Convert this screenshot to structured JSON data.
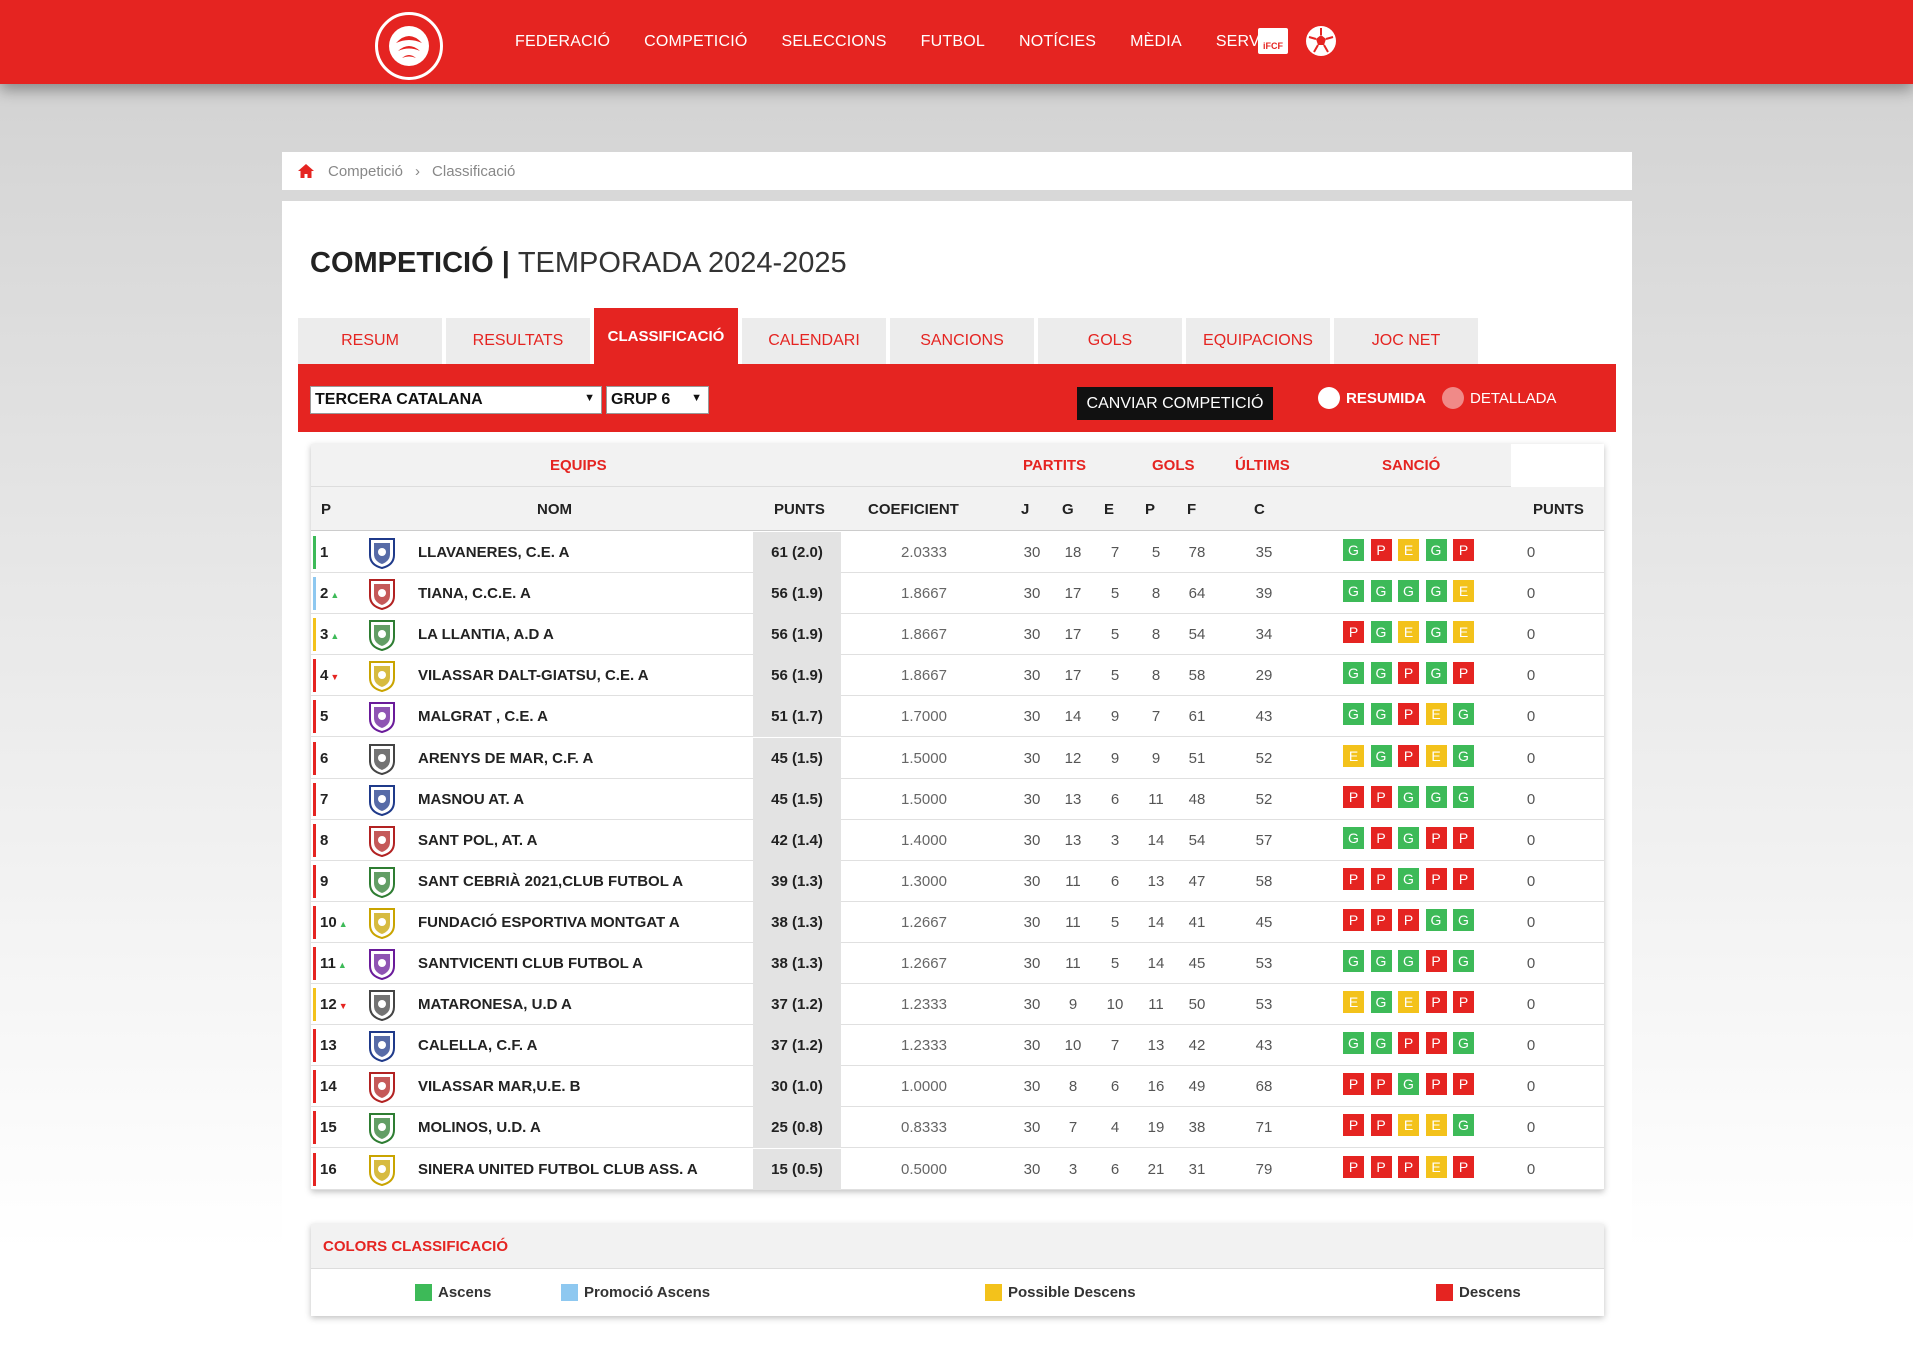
{
  "nav": {
    "items": [
      "FEDERACIÓ",
      "COMPETICIÓ",
      "SELECCIONS",
      "FUTBOL",
      "NOTÍCIES",
      "MÈDIA",
      "SERVEIS"
    ],
    "ifcf_label": "iFCF"
  },
  "breadcrumb": {
    "items": [
      "Competició",
      "Classificació"
    ],
    "separator": "›"
  },
  "title": {
    "bold": "COMPETICIÓ |",
    "light": "TEMPORADA 2024-2025"
  },
  "tabs": [
    "RESUM",
    "RESULTATS",
    "CLASSIFICACIÓ",
    "CALENDARI",
    "SANCIONS",
    "GOLS",
    "EQUIPACIONS",
    "JOC NET"
  ],
  "active_tab": "CLASSIFICACIÓ",
  "filters": {
    "competition": "TERCERA CATALANA",
    "group": "GRUP 6",
    "change_button": "CANVIAR COMPETICIÓ",
    "view_options": [
      "RESUMIDA",
      "DETALLADA"
    ],
    "selected_view": "RESUMIDA"
  },
  "table": {
    "group_headers": {
      "equips": "EQUIPS",
      "partits": "PARTITS",
      "gols": "GOLS",
      "ultims": "ÚLTIMS",
      "sancio": "SANCIÓ"
    },
    "columns": {
      "p": "P",
      "nom": "NOM",
      "punts": "PUNTS",
      "coef": "COEFICIENT",
      "j": "J",
      "g": "G",
      "e": "E",
      "pp": "P",
      "f": "F",
      "c": "C",
      "sanc": "PUNTS"
    },
    "rows": [
      {
        "pos": "1",
        "trend": "",
        "team": "LLAVANERES, C.E. A",
        "pts": "61 (2.0)",
        "coef": "2.0333",
        "j": "30",
        "g": "18",
        "e": "7",
        "p": "5",
        "f": "78",
        "c": "35",
        "form": [
          "G",
          "P",
          "E",
          "G",
          "P"
        ],
        "sanc": "0",
        "zone": "ascens"
      },
      {
        "pos": "2",
        "trend": "up",
        "team": "TIANA, C.C.E. A",
        "pts": "56 (1.9)",
        "coef": "1.8667",
        "j": "30",
        "g": "17",
        "e": "5",
        "p": "8",
        "f": "64",
        "c": "39",
        "form": [
          "G",
          "G",
          "G",
          "G",
          "E"
        ],
        "sanc": "0",
        "zone": "promocio"
      },
      {
        "pos": "3",
        "trend": "up",
        "team": "LA LLANTIA, A.D A",
        "pts": "56 (1.9)",
        "coef": "1.8667",
        "j": "30",
        "g": "17",
        "e": "5",
        "p": "8",
        "f": "54",
        "c": "34",
        "form": [
          "P",
          "G",
          "E",
          "G",
          "E"
        ],
        "sanc": "0",
        "zone": "possible"
      },
      {
        "pos": "4",
        "trend": "down",
        "team": "VILASSAR DALT-GIATSU, C.E. A",
        "pts": "56 (1.9)",
        "coef": "1.8667",
        "j": "30",
        "g": "17",
        "e": "5",
        "p": "8",
        "f": "58",
        "c": "29",
        "form": [
          "G",
          "G",
          "P",
          "G",
          "P"
        ],
        "sanc": "0",
        "zone": ""
      },
      {
        "pos": "5",
        "trend": "",
        "team": "MALGRAT , C.E. A",
        "pts": "51 (1.7)",
        "coef": "1.7000",
        "j": "30",
        "g": "14",
        "e": "9",
        "p": "7",
        "f": "61",
        "c": "43",
        "form": [
          "G",
          "G",
          "P",
          "E",
          "G"
        ],
        "sanc": "0",
        "zone": ""
      },
      {
        "pos": "6",
        "trend": "",
        "team": "ARENYS DE MAR, C.F. A",
        "pts": "45 (1.5)",
        "coef": "1.5000",
        "j": "30",
        "g": "12",
        "e": "9",
        "p": "9",
        "f": "51",
        "c": "52",
        "form": [
          "E",
          "G",
          "P",
          "E",
          "G"
        ],
        "sanc": "0",
        "zone": ""
      },
      {
        "pos": "7",
        "trend": "",
        "team": "MASNOU AT. A",
        "pts": "45 (1.5)",
        "coef": "1.5000",
        "j": "30",
        "g": "13",
        "e": "6",
        "p": "11",
        "f": "48",
        "c": "52",
        "form": [
          "P",
          "P",
          "G",
          "G",
          "G"
        ],
        "sanc": "0",
        "zone": ""
      },
      {
        "pos": "8",
        "trend": "",
        "team": "SANT POL, AT. A",
        "pts": "42 (1.4)",
        "coef": "1.4000",
        "j": "30",
        "g": "13",
        "e": "3",
        "p": "14",
        "f": "54",
        "c": "57",
        "form": [
          "G",
          "P",
          "G",
          "P",
          "P"
        ],
        "sanc": "0",
        "zone": ""
      },
      {
        "pos": "9",
        "trend": "",
        "team": "SANT CEBRIÀ 2021,CLUB FUTBOL A",
        "pts": "39 (1.3)",
        "coef": "1.3000",
        "j": "30",
        "g": "11",
        "e": "6",
        "p": "13",
        "f": "47",
        "c": "58",
        "form": [
          "P",
          "P",
          "G",
          "P",
          "P"
        ],
        "sanc": "0",
        "zone": ""
      },
      {
        "pos": "10",
        "trend": "up",
        "team": "FUNDACIÓ ESPORTIVA MONTGAT A",
        "pts": "38 (1.3)",
        "coef": "1.2667",
        "j": "30",
        "g": "11",
        "e": "5",
        "p": "14",
        "f": "41",
        "c": "45",
        "form": [
          "P",
          "P",
          "P",
          "G",
          "G"
        ],
        "sanc": "0",
        "zone": ""
      },
      {
        "pos": "11",
        "trend": "up",
        "team": "SANTVICENTI CLUB FUTBOL A",
        "pts": "38 (1.3)",
        "coef": "1.2667",
        "j": "30",
        "g": "11",
        "e": "5",
        "p": "14",
        "f": "45",
        "c": "53",
        "form": [
          "G",
          "G",
          "G",
          "P",
          "G"
        ],
        "sanc": "0",
        "zone": ""
      },
      {
        "pos": "12",
        "trend": "down",
        "team": "MATARONESA, U.D A",
        "pts": "37 (1.2)",
        "coef": "1.2333",
        "j": "30",
        "g": "9",
        "e": "10",
        "p": "11",
        "f": "50",
        "c": "53",
        "form": [
          "E",
          "G",
          "E",
          "P",
          "P"
        ],
        "sanc": "0",
        "zone": "possible"
      },
      {
        "pos": "13",
        "trend": "",
        "team": "CALELLA, C.F. A",
        "pts": "37 (1.2)",
        "coef": "1.2333",
        "j": "30",
        "g": "10",
        "e": "7",
        "p": "13",
        "f": "42",
        "c": "43",
        "form": [
          "G",
          "G",
          "P",
          "P",
          "G"
        ],
        "sanc": "0",
        "zone": "descens"
      },
      {
        "pos": "14",
        "trend": "",
        "team": "VILASSAR MAR,U.E. B",
        "pts": "30 (1.0)",
        "coef": "1.0000",
        "j": "30",
        "g": "8",
        "e": "6",
        "p": "16",
        "f": "49",
        "c": "68",
        "form": [
          "P",
          "P",
          "G",
          "P",
          "P"
        ],
        "sanc": "0",
        "zone": "descens"
      },
      {
        "pos": "15",
        "trend": "",
        "team": "MOLINOS, U.D. A",
        "pts": "25 (0.8)",
        "coef": "0.8333",
        "j": "30",
        "g": "7",
        "e": "4",
        "p": "19",
        "f": "38",
        "c": "71",
        "form": [
          "P",
          "P",
          "E",
          "E",
          "G"
        ],
        "sanc": "0",
        "zone": "descens"
      },
      {
        "pos": "16",
        "trend": "",
        "team": "SINERA UNITED FUTBOL CLUB ASS. A",
        "pts": "15 (0.5)",
        "coef": "0.5000",
        "j": "30",
        "g": "3",
        "e": "6",
        "p": "21",
        "f": "31",
        "c": "79",
        "form": [
          "P",
          "P",
          "P",
          "E",
          "P"
        ],
        "sanc": "0",
        "zone": "descens"
      }
    ]
  },
  "legend": {
    "title": "COLORS CLASSIFICACIÓ",
    "items": [
      {
        "label": "Ascens",
        "color": "#3dba58"
      },
      {
        "label": "Promoció Ascens",
        "color": "#8ec8f0"
      },
      {
        "label": "Possible Descens",
        "color": "#f3c21b"
      },
      {
        "label": "Descens",
        "color": "#e52421"
      }
    ]
  },
  "colors": {
    "brand_red": "#e52421",
    "win": "#3dba58",
    "loss": "#e52421",
    "draw": "#f3c21b",
    "promotion": "#8ec8f0"
  }
}
